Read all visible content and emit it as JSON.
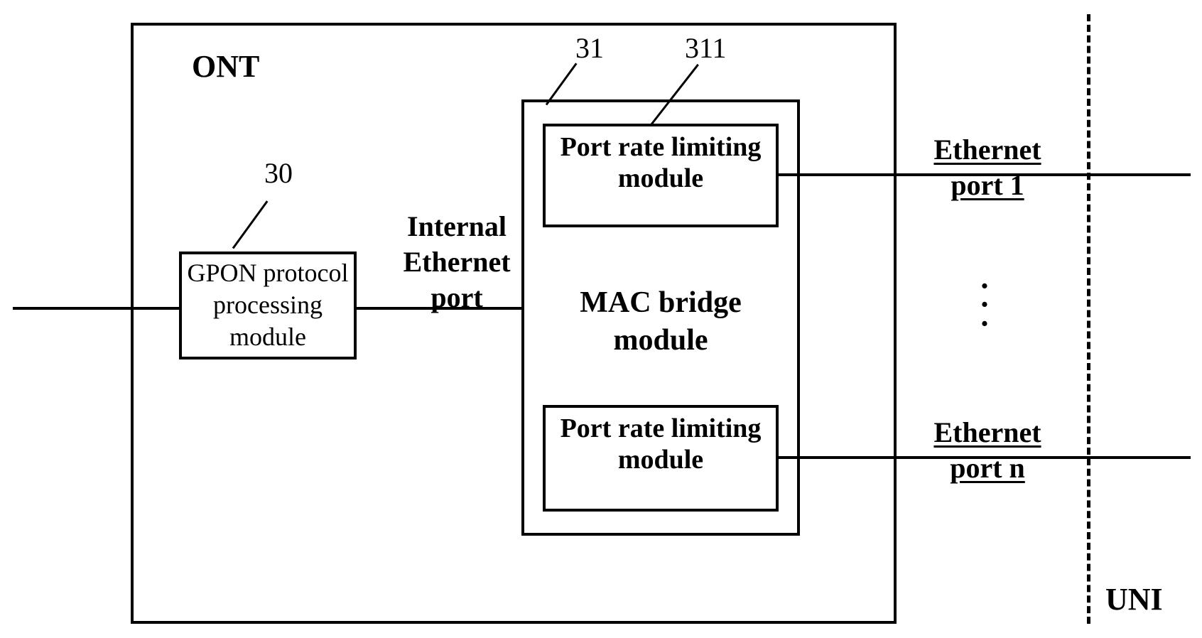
{
  "ont": {
    "title": "ONT",
    "ref30": "30",
    "ref31": "31",
    "ref311": "311",
    "gpon_module": "GPON protocol processing module",
    "internal_port": "Internal Ethernet port",
    "mac_bridge": "MAC bridge module",
    "port_rate_limiting_1": "Port rate limiting module",
    "port_rate_limiting_n": "Port rate limiting module"
  },
  "ports": {
    "eth1": "Ethernet port 1",
    "ethn": "Ethernet port n",
    "uni": "UNI"
  }
}
